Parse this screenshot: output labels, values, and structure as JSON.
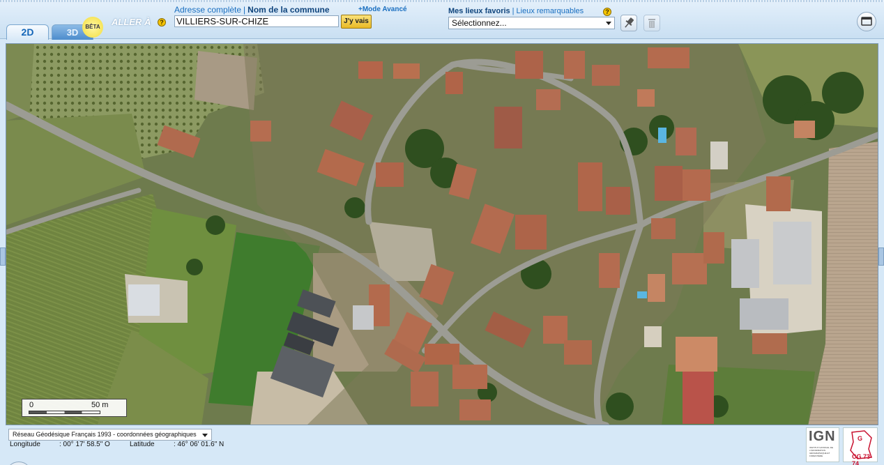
{
  "tabs": {
    "tab_2d": "2D",
    "tab_3d": "3D",
    "beta_badge": "BÊTA"
  },
  "goto": {
    "label": "ALLER À",
    "help": "?",
    "addr_link": "Adresse complète",
    "commune_link": "Nom de la commune",
    "separator": "|",
    "advanced_mode": "+Mode Avancé",
    "search_value": "VILLIERS-SUR-CHIZE",
    "go_button": "J'y vais"
  },
  "favorites": {
    "fav_link": "Mes lieux favoris",
    "remarkable_link": "Lieux remarquables",
    "separator": "|",
    "help": "?",
    "select_value": "Sélectionnez..."
  },
  "map": {
    "scale_zero": "0",
    "scale_label": "50 m"
  },
  "footer": {
    "projection": "Réseau Géodésique Français 1993 - coordonnées géographiques",
    "longitude_label": "Longitude",
    "longitude_value": ": 00° 17' 58.5\" O",
    "latitude_label": "Latitude",
    "latitude_value": ": 46° 06' 01.6\" N",
    "ign_logo": "IGN",
    "ign_subtext": "INSTITUT NATIONAL DE L'INFORMATION GÉOGRAPHIQUE ET FORESTIÈRE",
    "cg_logo": "CG 73-74"
  },
  "colors": {
    "tab_active": "#1466b8",
    "link": "#1a6fc0",
    "help_yellow": "#f5c400",
    "go_button": "#e9b925"
  },
  "icons": [
    "help-icon",
    "pin-icon",
    "trash-icon",
    "window-icon",
    "chevron-down-icon"
  ]
}
